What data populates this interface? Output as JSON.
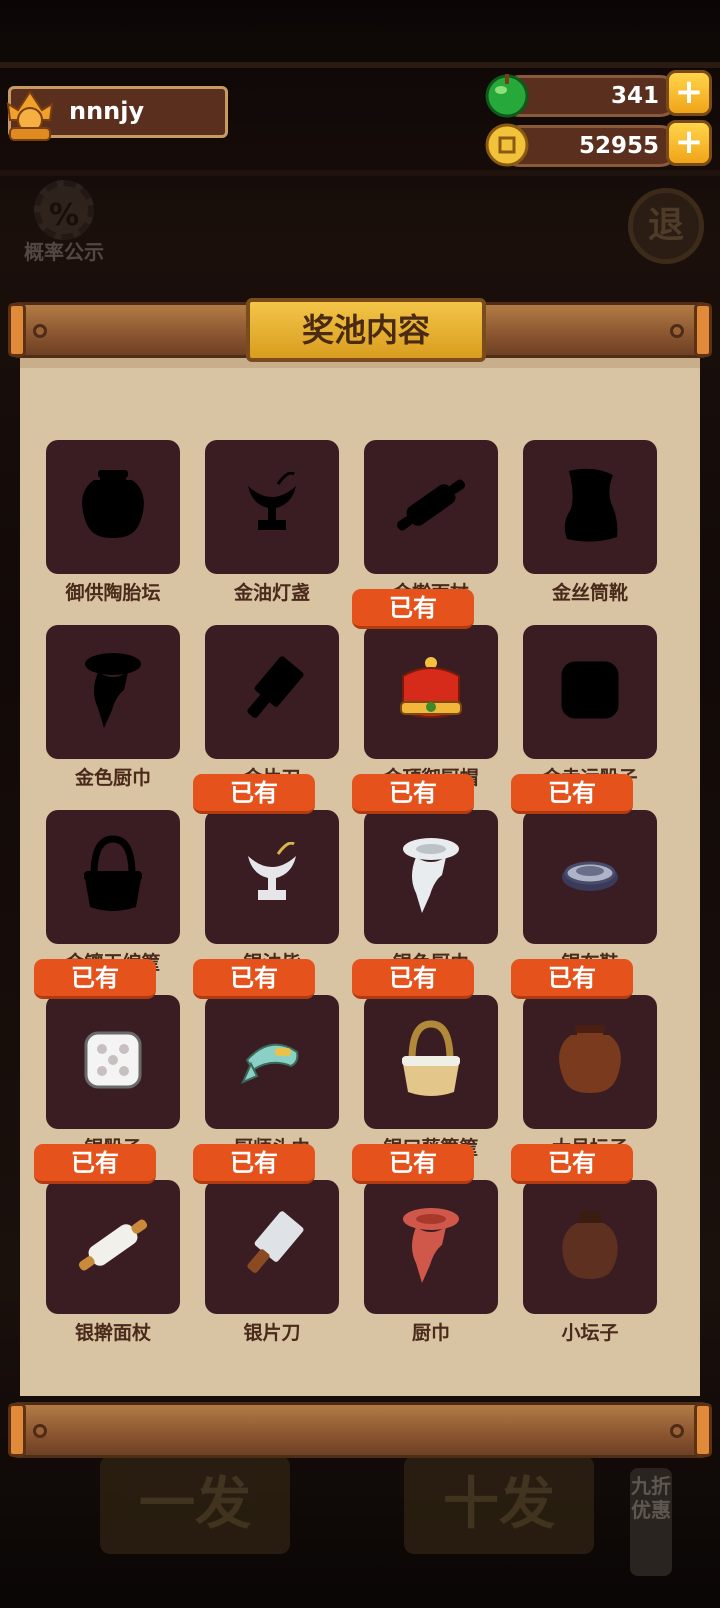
{
  "player": {
    "name": "nnnjy"
  },
  "currencies": [
    {
      "name": "jade",
      "icon": "jade-icon",
      "value": "341"
    },
    {
      "name": "coin",
      "icon": "coin-icon",
      "value": "52955"
    }
  ],
  "background": {
    "rate_label": "概率公示",
    "exit_label": "退",
    "single_draw_label": "一发",
    "ten_draw_label": "十发",
    "discount_label": "九折优惠"
  },
  "panel": {
    "title": "奖池内容",
    "owned_badge": "已有",
    "items": [
      {
        "name": "御供陶胎坛",
        "owned": false,
        "icon": "pot-icon"
      },
      {
        "name": "金油灯盏",
        "owned": false,
        "icon": "oil-lamp-icon"
      },
      {
        "name": "金擀面杖",
        "owned": false,
        "icon": "rolling-pin-icon"
      },
      {
        "name": "金丝筒靴",
        "owned": false,
        "icon": "boot-icon"
      },
      {
        "name": "金色厨巾",
        "owned": false,
        "icon": "scarf-icon"
      },
      {
        "name": "金片刀",
        "owned": false,
        "icon": "cleaver-icon"
      },
      {
        "name": "金顶御厨帽",
        "owned": true,
        "icon": "chef-hat-icon"
      },
      {
        "name": "金幸运骰子",
        "owned": false,
        "icon": "dice-icon"
      },
      {
        "name": "金镶玉编筐",
        "owned": false,
        "icon": "basket-icon"
      },
      {
        "name": "银油皆",
        "owned": true,
        "icon": "oil-lamp-icon"
      },
      {
        "name": "银色厨巾",
        "owned": true,
        "icon": "scarf-icon"
      },
      {
        "name": "银布鞋",
        "owned": true,
        "icon": "shoe-icon"
      },
      {
        "name": "银骰子",
        "owned": true,
        "icon": "dice-icon"
      },
      {
        "name": "厨师头巾",
        "owned": true,
        "icon": "bandana-icon"
      },
      {
        "name": "银口藤箩筐",
        "owned": true,
        "icon": "basket-icon"
      },
      {
        "name": "大号坛子",
        "owned": true,
        "icon": "pot-icon"
      },
      {
        "name": "银擀面杖",
        "owned": true,
        "icon": "rolling-pin-icon"
      },
      {
        "name": "银片刀",
        "owned": true,
        "icon": "cleaver-icon"
      },
      {
        "name": "厨巾",
        "owned": true,
        "icon": "scarf-icon"
      },
      {
        "name": "小坛子",
        "owned": true,
        "icon": "small-pot-icon"
      }
    ]
  },
  "colors": {
    "tile": "#3a1d22",
    "badge": "#e5521c",
    "panel": "#d8c3a3"
  }
}
